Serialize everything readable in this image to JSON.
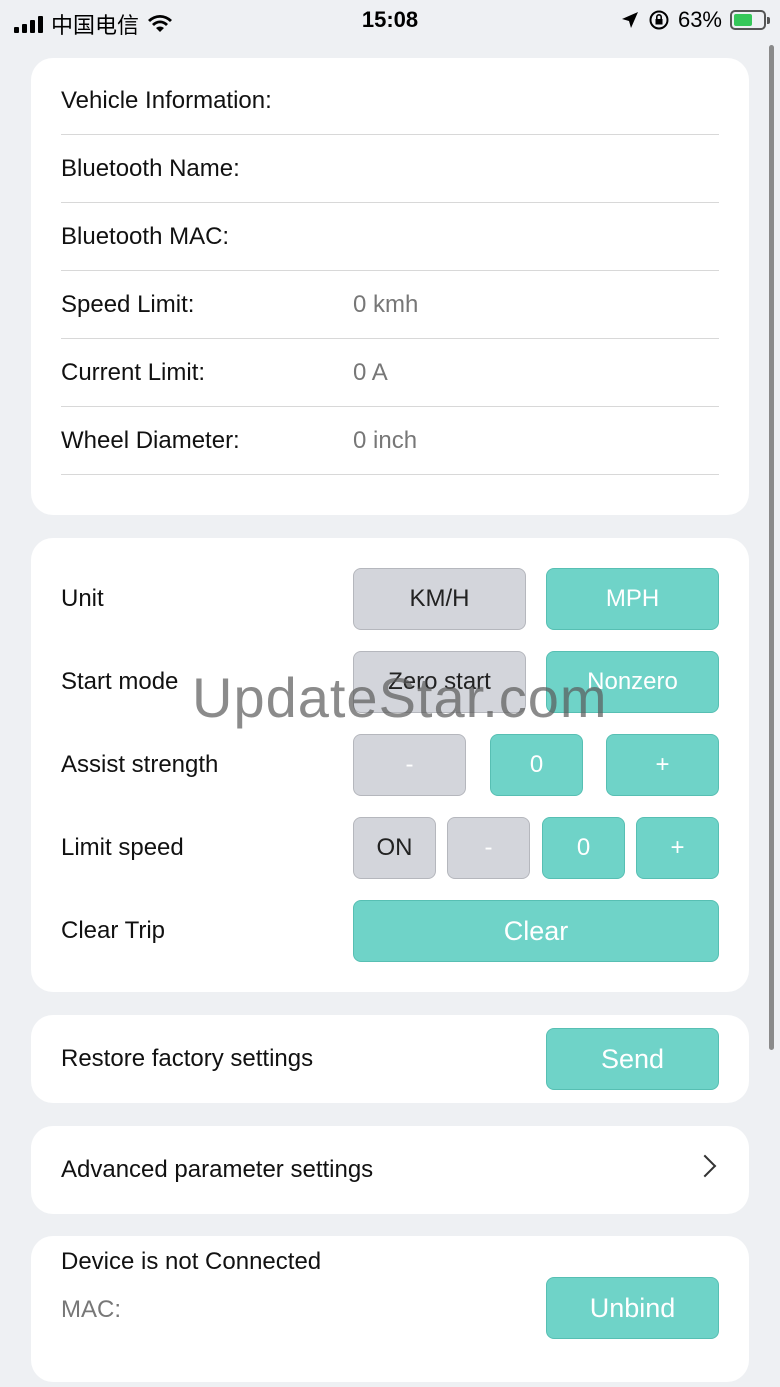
{
  "status_bar": {
    "carrier": "中国电信",
    "time": "15:08",
    "battery_percent": "63%"
  },
  "vehicle_info": {
    "title": "Vehicle Information:",
    "bluetooth_name_label": "Bluetooth Name:",
    "bluetooth_mac_label": "Bluetooth MAC:",
    "speed_limit_label": "Speed Limit:",
    "speed_limit_value": "0 kmh",
    "current_limit_label": "Current Limit:",
    "current_limit_value": "0 A",
    "wheel_diameter_label": "Wheel Diameter:",
    "wheel_diameter_value": "0 inch"
  },
  "controls": {
    "unit_label": "Unit",
    "unit_kmh": "KM/H",
    "unit_mph": "MPH",
    "start_mode_label": "Start mode",
    "start_zero": "Zero start",
    "start_nonzero": "Nonzero",
    "assist_label": "Assist strength",
    "assist_minus": "-",
    "assist_value": "0",
    "assist_plus": "+",
    "limit_label": "Limit speed",
    "limit_toggle": "ON",
    "limit_minus": "-",
    "limit_value": "0",
    "limit_plus": "+",
    "clear_trip_label": "Clear Trip",
    "clear_button": "Clear"
  },
  "restore": {
    "label": "Restore factory settings",
    "button": "Send"
  },
  "advanced": {
    "label": "Advanced parameter settings"
  },
  "device": {
    "status": "Device is not Connected",
    "mac_label": "MAC:",
    "unbind_button": "Unbind"
  },
  "watermark": "UpdateStar.com",
  "colors": {
    "accent": "#6fd3c8",
    "inactive": "#d3d5db",
    "background": "#eef0f3"
  }
}
